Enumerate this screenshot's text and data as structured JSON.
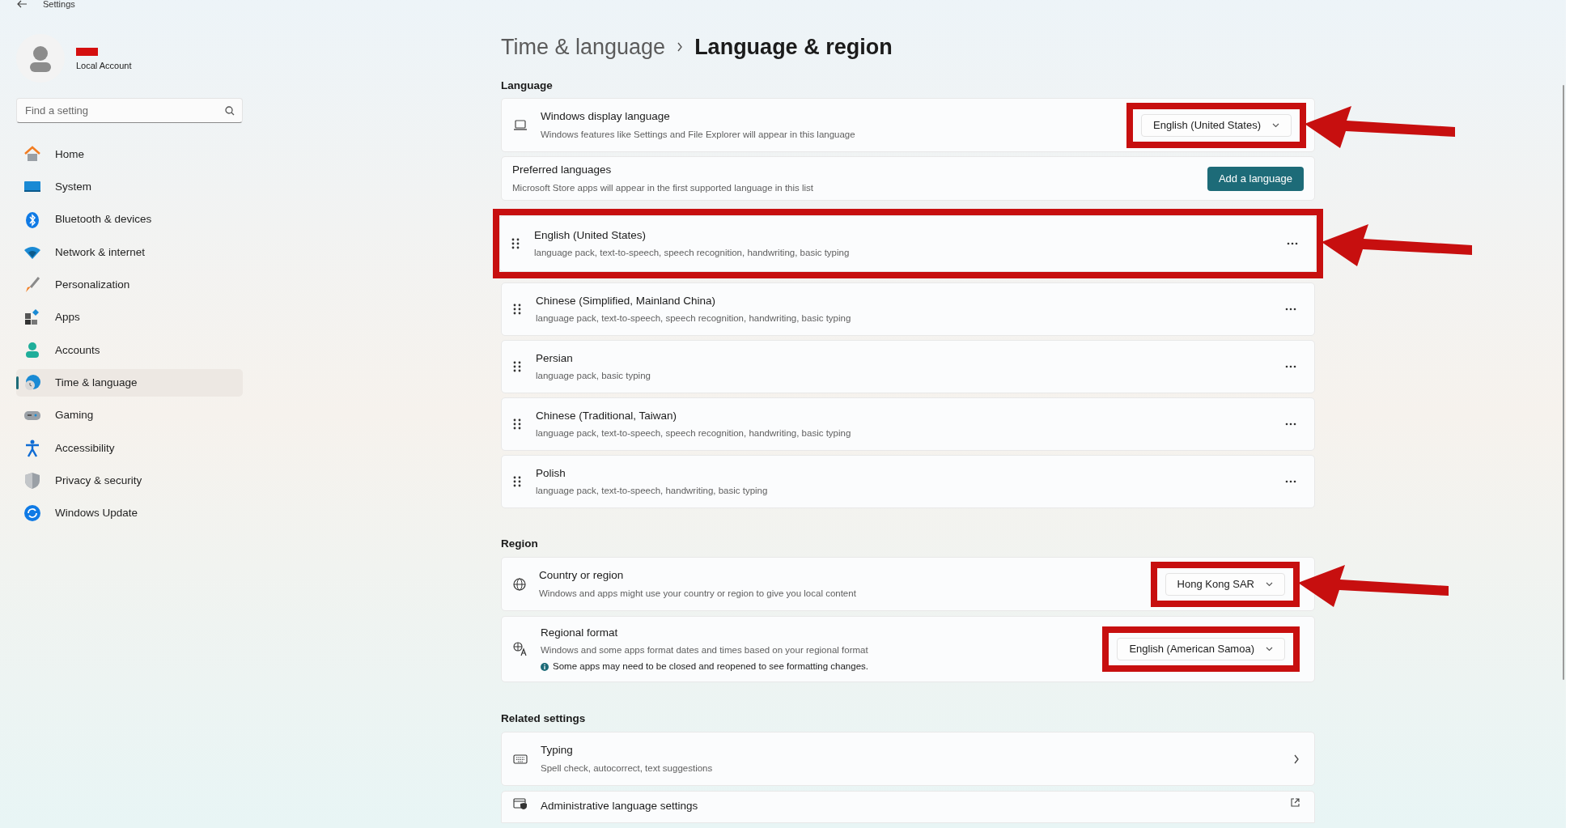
{
  "window": {
    "title": "Settings"
  },
  "account": {
    "type": "Local Account"
  },
  "search": {
    "placeholder": "Find a setting"
  },
  "nav": [
    {
      "label": "Home",
      "selected": false
    },
    {
      "label": "System",
      "selected": false
    },
    {
      "label": "Bluetooth & devices",
      "selected": false
    },
    {
      "label": "Network & internet",
      "selected": false
    },
    {
      "label": "Personalization",
      "selected": false
    },
    {
      "label": "Apps",
      "selected": false
    },
    {
      "label": "Accounts",
      "selected": false
    },
    {
      "label": "Time & language",
      "selected": true
    },
    {
      "label": "Gaming",
      "selected": false
    },
    {
      "label": "Accessibility",
      "selected": false
    },
    {
      "label": "Privacy & security",
      "selected": false
    },
    {
      "label": "Windows Update",
      "selected": false
    }
  ],
  "breadcrumb": {
    "parent": "Time & language",
    "current": "Language & region"
  },
  "language_section": {
    "heading": "Language",
    "display_language": {
      "title": "Windows display language",
      "description": "Windows features like Settings and File Explorer will appear in this language",
      "value": "English (United States)",
      "highlighted": true,
      "arrow": true
    },
    "preferred": {
      "title": "Preferred languages",
      "description": "Microsoft Store apps will appear in the first supported language in this list",
      "button": "Add a language"
    },
    "languages": [
      {
        "name": "English (United States)",
        "features": "language pack, text-to-speech, speech recognition, handwriting, basic typing",
        "highlighted": true
      },
      {
        "name": "Chinese (Simplified, Mainland China)",
        "features": "language pack, text-to-speech, speech recognition, handwriting, basic typing",
        "highlighted": false
      },
      {
        "name": "Persian",
        "features": "language pack, basic typing",
        "highlighted": false
      },
      {
        "name": "Chinese (Traditional, Taiwan)",
        "features": "language pack, text-to-speech, speech recognition, handwriting, basic typing",
        "highlighted": false
      },
      {
        "name": "Polish",
        "features": "language pack, text-to-speech, handwriting, basic typing",
        "highlighted": false
      }
    ]
  },
  "region_section": {
    "heading": "Region",
    "items": [
      {
        "title": "Country or region",
        "description": "Windows and apps might use your country or region to give you local content",
        "value": "Hong Kong SAR",
        "highlighted": true,
        "arrow": true
      },
      {
        "title": "Regional format",
        "description": "Windows and some apps format dates and times based on your regional format",
        "note": "Some apps may need to be closed and reopened to see formatting changes.",
        "value": "English (American Samoa)",
        "highlighted": true,
        "arrow": false
      }
    ]
  },
  "related": {
    "heading": "Related settings",
    "items": [
      {
        "title": "Typing",
        "description": "Spell check, autocorrect, text suggestions",
        "kind": "chevron"
      },
      {
        "title": "Administrative language settings",
        "kind": "external"
      }
    ]
  }
}
